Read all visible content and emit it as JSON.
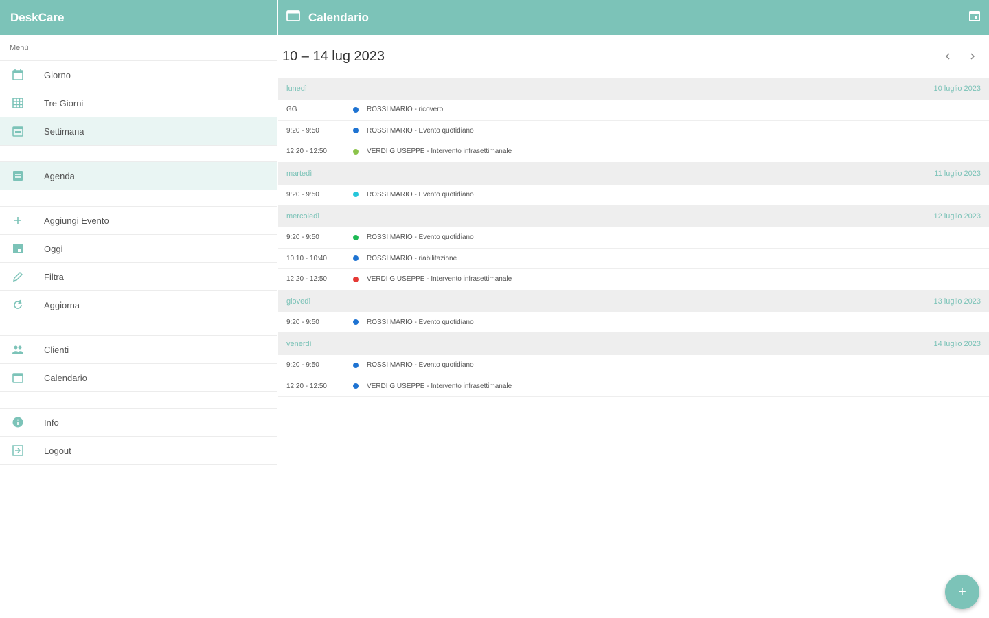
{
  "app": {
    "title": "DeskCare"
  },
  "sidebar": {
    "caption": "Menù",
    "items_top": [
      {
        "label": "Giorno",
        "icon": "calendar-day-icon"
      },
      {
        "label": "Tre Giorni",
        "icon": "grid-icon"
      },
      {
        "label": "Settimana",
        "icon": "calendar-week-icon"
      }
    ],
    "agenda": {
      "label": "Agenda",
      "icon": "agenda-icon"
    },
    "items_actions": [
      {
        "label": "Aggiungi Evento",
        "icon": "plus-icon"
      },
      {
        "label": "Oggi",
        "icon": "today-icon"
      },
      {
        "label": "Filtra",
        "icon": "pencil-icon"
      },
      {
        "label": "Aggiorna",
        "icon": "refresh-icon"
      }
    ],
    "items_data": [
      {
        "label": "Clienti",
        "icon": "people-icon"
      },
      {
        "label": "Calendario",
        "icon": "calendar-icon"
      }
    ],
    "items_other": [
      {
        "label": "Info",
        "icon": "info-icon"
      },
      {
        "label": "Logout",
        "icon": "logout-icon"
      }
    ]
  },
  "main": {
    "title": "Calendario",
    "range": "10 – 14 lug 2023"
  },
  "colors": {
    "accent": "#7cc3b8",
    "blue": "#1e73d2",
    "green": "#1db954",
    "lime": "#8bc34a",
    "red": "#e53935",
    "teal": "#26c6da"
  },
  "days": [
    {
      "weekday": "lunedì",
      "date": "10 luglio 2023",
      "events": [
        {
          "time": "GG",
          "color": "#1e73d2",
          "desc": "ROSSI MARIO - ricovero"
        },
        {
          "time": "9:20 - 9:50",
          "color": "#1e73d2",
          "desc": "ROSSI MARIO - Evento quotidiano"
        },
        {
          "time": "12:20 - 12:50",
          "color": "#8bc34a",
          "desc": "VERDI GIUSEPPE - Intervento infrasettimanale"
        }
      ]
    },
    {
      "weekday": "martedì",
      "date": "11 luglio 2023",
      "events": [
        {
          "time": "9:20 - 9:50",
          "color": "#26c6da",
          "desc": "ROSSI MARIO - Evento quotidiano"
        }
      ]
    },
    {
      "weekday": "mercoledì",
      "date": "12 luglio 2023",
      "events": [
        {
          "time": "9:20 - 9:50",
          "color": "#1db954",
          "desc": "ROSSI MARIO - Evento quotidiano"
        },
        {
          "time": "10:10 - 10:40",
          "color": "#1e73d2",
          "desc": "ROSSI MARIO - riabilitazione"
        },
        {
          "time": "12:20 - 12:50",
          "color": "#e53935",
          "desc": "VERDI GIUSEPPE - Intervento infrasettimanale"
        }
      ]
    },
    {
      "weekday": "giovedì",
      "date": "13 luglio 2023",
      "events": [
        {
          "time": "9:20 - 9:50",
          "color": "#1e73d2",
          "desc": "ROSSI MARIO - Evento quotidiano"
        }
      ]
    },
    {
      "weekday": "venerdì",
      "date": "14 luglio 2023",
      "events": [
        {
          "time": "9:20 - 9:50",
          "color": "#1e73d2",
          "desc": "ROSSI MARIO - Evento quotidiano"
        },
        {
          "time": "12:20 - 12:50",
          "color": "#1e73d2",
          "desc": "VERDI GIUSEPPE - Intervento infrasettimanale"
        }
      ]
    }
  ],
  "fab": {
    "label": "+",
    "icon": "plus-icon"
  }
}
